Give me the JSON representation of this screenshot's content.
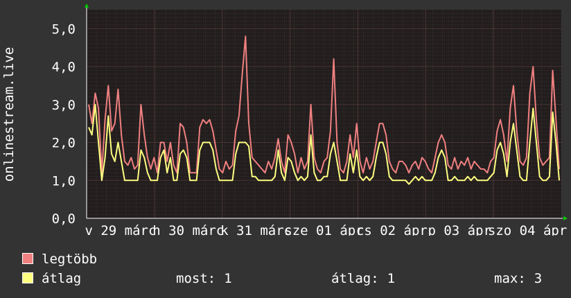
{
  "chart_data": {
    "type": "line",
    "ylabel": "onlinestream.live",
    "ylim": [
      0,
      5.5
    ],
    "yticks": [
      {
        "value": 0,
        "label": "0,0"
      },
      {
        "value": 1,
        "label": "1,0"
      },
      {
        "value": 2,
        "label": "2,0"
      },
      {
        "value": 3,
        "label": "3,0"
      },
      {
        "value": 4,
        "label": "4,0"
      },
      {
        "value": 5,
        "label": "5,0"
      }
    ],
    "xticks": [
      "v 29 márc",
      "h 30 márc",
      "k 31 márc",
      "sze 01 ápr",
      "cs 02 ápr",
      "p 03 ápr",
      "szo 04 ápr"
    ],
    "series": [
      {
        "name": "legtöbb",
        "color": "#f08080",
        "values": [
          3.0,
          2.5,
          3.3,
          2.9,
          1.2,
          2.6,
          3.5,
          2.3,
          2.5,
          3.4,
          2.2,
          1.5,
          1.4,
          1.6,
          1.3,
          1.4,
          3.0,
          2.2,
          1.6,
          1.3,
          1.6,
          1.2,
          2.0,
          2.0,
          1.5,
          2.0,
          1.4,
          1.2,
          2.5,
          2.4,
          2.0,
          1.2,
          1.2,
          1.2,
          2.4,
          2.6,
          2.5,
          2.6,
          2.3,
          1.8,
          1.3,
          1.2,
          1.5,
          1.3,
          1.4,
          2.3,
          2.7,
          3.8,
          4.8,
          2.5,
          1.6,
          1.5,
          1.4,
          1.3,
          1.2,
          1.5,
          1.3,
          1.6,
          2.1,
          1.5,
          1.2,
          2.2,
          2.0,
          1.7,
          1.2,
          1.6,
          1.3,
          1.5,
          3.0,
          1.6,
          1.3,
          1.2,
          1.5,
          1.6,
          2.3,
          4.2,
          2.0,
          1.3,
          1.2,
          1.5,
          2.2,
          1.6,
          2.5,
          1.5,
          1.2,
          1.6,
          1.3,
          1.5,
          2.0,
          2.5,
          2.5,
          2.2,
          1.5,
          1.3,
          1.2,
          1.5,
          1.5,
          1.4,
          1.2,
          1.4,
          1.5,
          1.3,
          1.6,
          1.5,
          1.3,
          1.2,
          1.6,
          2.0,
          2.2,
          2.0,
          1.4,
          1.3,
          1.6,
          1.3,
          1.5,
          1.4,
          1.6,
          1.3,
          1.5,
          1.4,
          1.3,
          1.3,
          1.2,
          1.5,
          1.6,
          2.3,
          2.6,
          2.2,
          1.5,
          2.9,
          3.5,
          2.3,
          1.5,
          1.4,
          1.6,
          3.3,
          4.0,
          2.6,
          1.6,
          1.4,
          1.5,
          1.6,
          3.9,
          2.6,
          1.3
        ]
      },
      {
        "name": "átlag",
        "color": "#ffff80",
        "values": [
          2.4,
          2.2,
          3.0,
          2.0,
          1.0,
          1.6,
          2.7,
          1.7,
          1.5,
          2.0,
          1.5,
          1.0,
          1.0,
          1.0,
          1.0,
          1.0,
          1.8,
          1.6,
          1.2,
          1.0,
          1.0,
          1.0,
          1.6,
          1.8,
          1.2,
          1.6,
          1.0,
          1.0,
          1.7,
          1.8,
          1.6,
          1.0,
          1.0,
          1.0,
          1.8,
          2.0,
          2.0,
          2.0,
          1.8,
          1.3,
          1.0,
          1.0,
          1.0,
          1.0,
          1.0,
          1.7,
          2.0,
          2.0,
          2.0,
          1.9,
          1.1,
          1.1,
          1.0,
          1.0,
          1.0,
          1.0,
          1.0,
          1.1,
          1.8,
          1.2,
          1.0,
          1.6,
          1.5,
          1.2,
          1.0,
          1.1,
          1.0,
          1.1,
          2.2,
          1.2,
          1.0,
          1.0,
          1.1,
          1.1,
          1.7,
          2.0,
          1.5,
          1.0,
          1.0,
          1.0,
          1.7,
          1.2,
          1.8,
          1.1,
          1.0,
          1.1,
          1.0,
          1.1,
          1.6,
          2.0,
          2.0,
          1.7,
          1.1,
          1.0,
          1.0,
          1.0,
          1.0,
          1.0,
          0.9,
          1.0,
          1.1,
          1.0,
          1.1,
          1.0,
          1.0,
          1.0,
          1.2,
          1.6,
          1.8,
          1.6,
          1.0,
          1.0,
          1.1,
          1.0,
          1.0,
          1.0,
          1.1,
          1.0,
          1.1,
          1.0,
          1.0,
          1.0,
          1.0,
          1.1,
          1.2,
          1.8,
          2.0,
          1.7,
          1.1,
          2.0,
          2.5,
          1.8,
          1.1,
          1.0,
          1.0,
          2.0,
          2.9,
          2.0,
          1.1,
          1.0,
          1.0,
          1.1,
          2.8,
          2.0,
          1.0
        ]
      }
    ],
    "grid": true,
    "legend_placement": "bottom-left",
    "colors": {
      "background": "#333333",
      "plot_area": "#231e1e",
      "grid_major": "#6f4a4a",
      "grid_minor": "#3e3232",
      "axis": "#ffffff",
      "arrow": "#00cc00"
    }
  },
  "legend": {
    "items": [
      {
        "label": "legtöbb",
        "color": "#f08080"
      },
      {
        "label": "átlag",
        "color": "#ffff80"
      }
    ],
    "stats": {
      "now_label": "most:",
      "now_value": "1",
      "avg_label": "átlag:",
      "avg_value": "1",
      "max_label": "max:",
      "max_value": "3"
    }
  }
}
